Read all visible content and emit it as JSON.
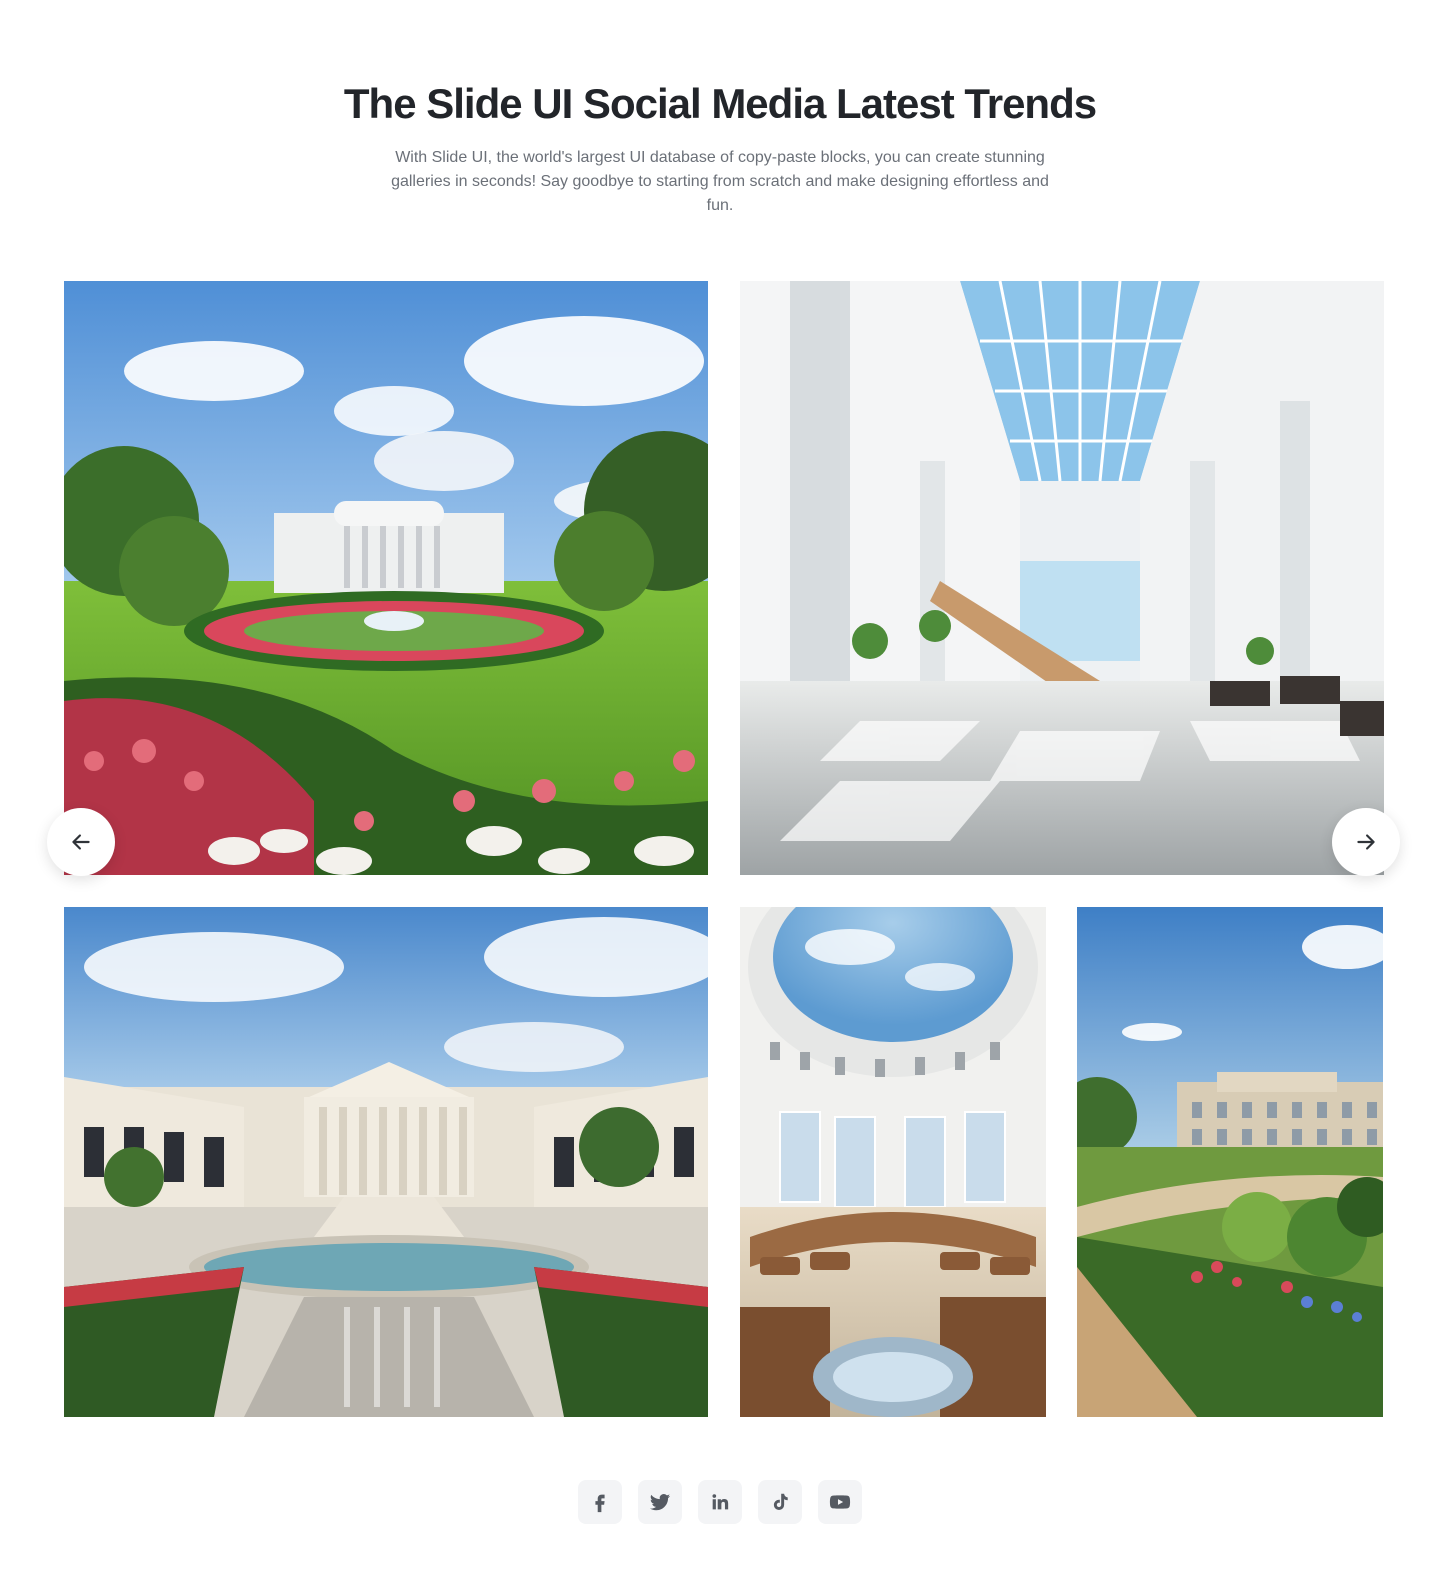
{
  "header": {
    "title": "The Slide UI Social Media Latest Trends",
    "subtitle": "With Slide UI, the world's largest UI database of copy-paste blocks, you can create stunning galleries in seconds! Say goodbye to starting from scratch and make designing effortless and fun."
  },
  "gallery": {
    "photos": [
      {
        "subject": "mansion-garden-fountain"
      },
      {
        "subject": "bright-atrium-interior"
      },
      {
        "subject": "neoclassical-building-pool"
      },
      {
        "subject": "domed-chamber-interior"
      },
      {
        "subject": "palace-garden"
      }
    ],
    "prev_icon": "arrow-left-icon",
    "next_icon": "arrow-right-icon"
  },
  "socials": [
    {
      "name": "facebook",
      "icon": "facebook-icon"
    },
    {
      "name": "twitter",
      "icon": "twitter-icon"
    },
    {
      "name": "linkedin",
      "icon": "linkedin-icon"
    },
    {
      "name": "tiktok",
      "icon": "tiktok-icon"
    },
    {
      "name": "youtube",
      "icon": "youtube-icon"
    }
  ],
  "colors": {
    "title": "#22252a",
    "subtitle": "#6b7078",
    "social_bg": "#f3f4f6",
    "social_icon": "#555a62"
  }
}
